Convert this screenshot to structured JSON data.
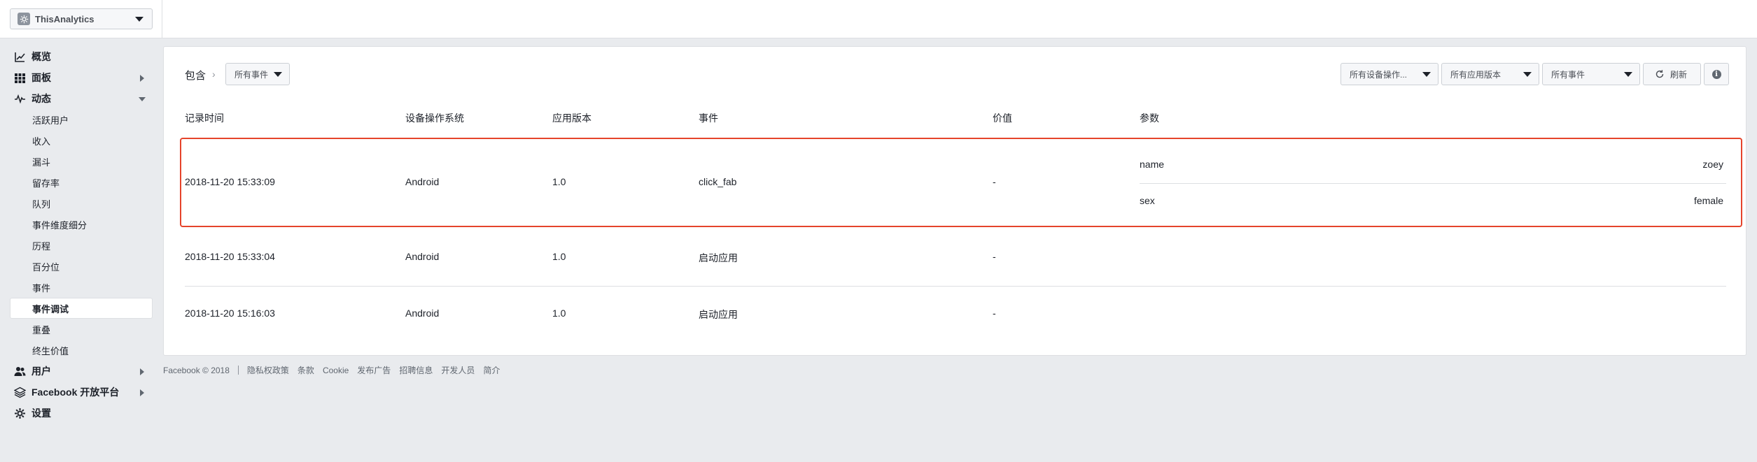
{
  "app": {
    "name": "ThisAnalytics",
    "icon": "gear-logo-icon"
  },
  "sidebar": {
    "items": [
      {
        "label": "概览",
        "icon": "chart-icon"
      },
      {
        "label": "面板",
        "icon": "grid-icon"
      },
      {
        "label": "动态",
        "icon": "activity-icon"
      },
      {
        "label": "用户",
        "icon": "users-icon"
      },
      {
        "label": "Facebook 开放平台",
        "icon": "layers-icon"
      },
      {
        "label": "设置",
        "icon": "gear-icon"
      }
    ],
    "subitems": [
      "活跃用户",
      "收入",
      "漏斗",
      "留存率",
      "队列",
      "事件维度细分",
      "历程",
      "百分位",
      "事件",
      "事件调试",
      "重叠",
      "终生价值"
    ]
  },
  "filter": {
    "include_label": "包含",
    "events_dropdown": "所有事件",
    "os_dropdown": "所有设备操作...",
    "version_dropdown": "所有应用版本",
    "events_dropdown_right": "所有事件",
    "refresh_label": "刷新",
    "info_label": "i"
  },
  "table": {
    "headers": [
      "记录时间",
      "设备操作系统",
      "应用版本",
      "事件",
      "价值",
      "参数"
    ],
    "rows": [
      {
        "time": "2018-11-20 15:33:09",
        "os": "Android",
        "version": "1.0",
        "event": "click_fab",
        "value": "-",
        "params": [
          {
            "key": "name",
            "value": "zoey"
          },
          {
            "key": "sex",
            "value": "female"
          }
        ]
      },
      {
        "time": "2018-11-20 15:33:04",
        "os": "Android",
        "version": "1.0",
        "event": "启动应用",
        "value": "-",
        "params": []
      },
      {
        "time": "2018-11-20 15:16:03",
        "os": "Android",
        "version": "1.0",
        "event": "启动应用",
        "value": "-",
        "params": []
      }
    ]
  },
  "footer": {
    "copyright": "Facebook © 2018",
    "links": [
      "隐私权政策",
      "条款",
      "Cookie",
      "发布广告",
      "招聘信息",
      "开发人员",
      "简介"
    ]
  },
  "colors": {
    "highlight": "#e5442b",
    "background": "#e9ebee",
    "panel": "#ffffff"
  }
}
